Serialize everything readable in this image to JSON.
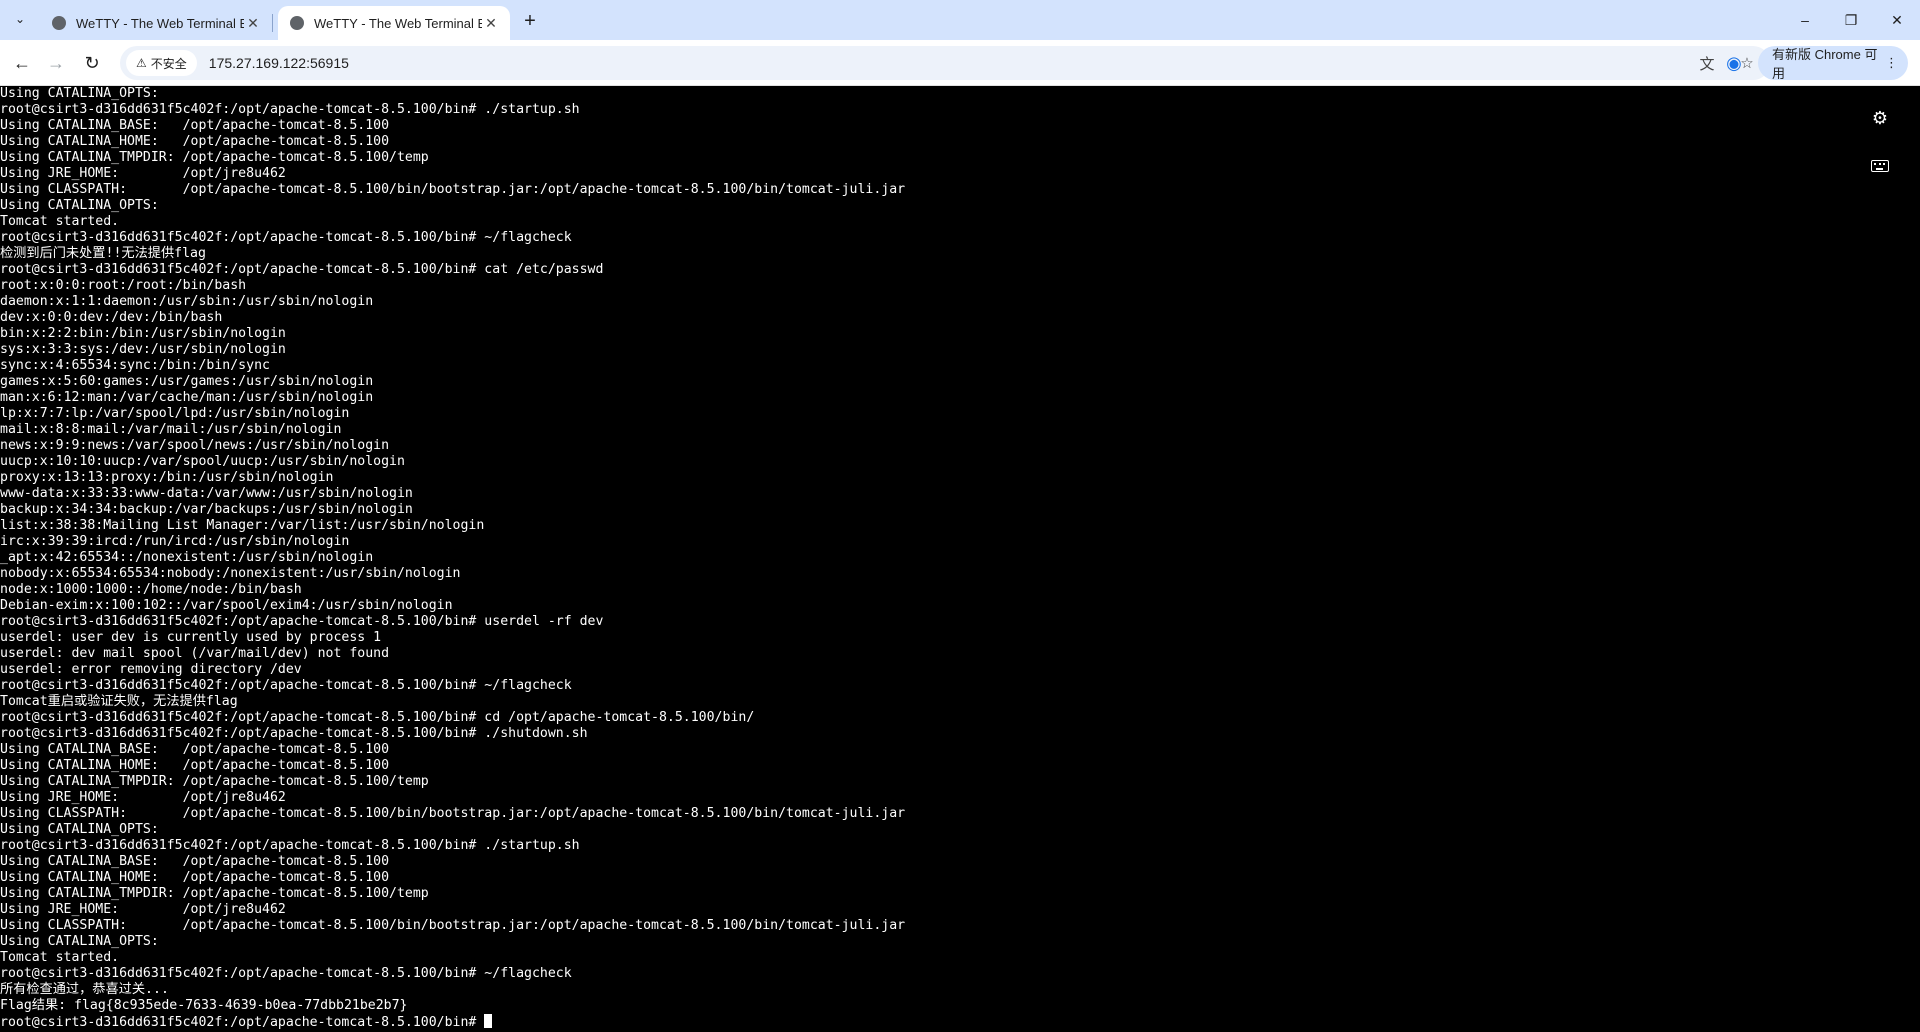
{
  "browser": {
    "tabs": [
      {
        "title": "WeTTY - The Web Terminal E",
        "active": false
      },
      {
        "title": "WeTTY - The Web Terminal E",
        "active": true
      }
    ],
    "tab_search_icon": "chevron-down-icon",
    "new_tab_icon": "plus-icon",
    "window_controls": {
      "minimize": "–",
      "maximize": "❐",
      "close": "✕"
    },
    "nav": {
      "back": "←",
      "forward": "→",
      "reload": "↻"
    },
    "security_label": "不安全",
    "url": "175.27.169.122:56915",
    "update_label": "有新版 Chrome 可用",
    "accent_color": "#d3e3fd"
  },
  "terminal": {
    "lines": [
      "Using CATALINA_OPTS:",
      "root@csirt3-d316dd631f5c402f:/opt/apache-tomcat-8.5.100/bin# ./startup.sh",
      "Using CATALINA_BASE:   /opt/apache-tomcat-8.5.100",
      "Using CATALINA_HOME:   /opt/apache-tomcat-8.5.100",
      "Using CATALINA_TMPDIR: /opt/apache-tomcat-8.5.100/temp",
      "Using JRE_HOME:        /opt/jre8u462",
      "Using CLASSPATH:       /opt/apache-tomcat-8.5.100/bin/bootstrap.jar:/opt/apache-tomcat-8.5.100/bin/tomcat-juli.jar",
      "Using CATALINA_OPTS:",
      "Tomcat started.",
      "root@csirt3-d316dd631f5c402f:/opt/apache-tomcat-8.5.100/bin# ~/flagcheck",
      "检测到后门未处置!!无法提供flag",
      "root@csirt3-d316dd631f5c402f:/opt/apache-tomcat-8.5.100/bin# cat /etc/passwd",
      "root:x:0:0:root:/root:/bin/bash",
      "daemon:x:1:1:daemon:/usr/sbin:/usr/sbin/nologin",
      "dev:x:0:0:dev:/dev:/bin/bash",
      "bin:x:2:2:bin:/bin:/usr/sbin/nologin",
      "sys:x:3:3:sys:/dev:/usr/sbin/nologin",
      "sync:x:4:65534:sync:/bin:/bin/sync",
      "games:x:5:60:games:/usr/games:/usr/sbin/nologin",
      "man:x:6:12:man:/var/cache/man:/usr/sbin/nologin",
      "lp:x:7:7:lp:/var/spool/lpd:/usr/sbin/nologin",
      "mail:x:8:8:mail:/var/mail:/usr/sbin/nologin",
      "news:x:9:9:news:/var/spool/news:/usr/sbin/nologin",
      "uucp:x:10:10:uucp:/var/spool/uucp:/usr/sbin/nologin",
      "proxy:x:13:13:proxy:/bin:/usr/sbin/nologin",
      "www-data:x:33:33:www-data:/var/www:/usr/sbin/nologin",
      "backup:x:34:34:backup:/var/backups:/usr/sbin/nologin",
      "list:x:38:38:Mailing List Manager:/var/list:/usr/sbin/nologin",
      "irc:x:39:39:ircd:/run/ircd:/usr/sbin/nologin",
      "_apt:x:42:65534::/nonexistent:/usr/sbin/nologin",
      "nobody:x:65534:65534:nobody:/nonexistent:/usr/sbin/nologin",
      "node:x:1000:1000::/home/node:/bin/bash",
      "Debian-exim:x:100:102::/var/spool/exim4:/usr/sbin/nologin",
      "root@csirt3-d316dd631f5c402f:/opt/apache-tomcat-8.5.100/bin# userdel -rf dev",
      "userdel: user dev is currently used by process 1",
      "userdel: dev mail spool (/var/mail/dev) not found",
      "userdel: error removing directory /dev",
      "root@csirt3-d316dd631f5c402f:/opt/apache-tomcat-8.5.100/bin# ~/flagcheck",
      "Tomcat重启或验证失败，无法提供flag",
      "root@csirt3-d316dd631f5c402f:/opt/apache-tomcat-8.5.100/bin# cd /opt/apache-tomcat-8.5.100/bin/",
      "root@csirt3-d316dd631f5c402f:/opt/apache-tomcat-8.5.100/bin# ./shutdown.sh",
      "Using CATALINA_BASE:   /opt/apache-tomcat-8.5.100",
      "Using CATALINA_HOME:   /opt/apache-tomcat-8.5.100",
      "Using CATALINA_TMPDIR: /opt/apache-tomcat-8.5.100/temp",
      "Using JRE_HOME:        /opt/jre8u462",
      "Using CLASSPATH:       /opt/apache-tomcat-8.5.100/bin/bootstrap.jar:/opt/apache-tomcat-8.5.100/bin/tomcat-juli.jar",
      "Using CATALINA_OPTS:",
      "root@csirt3-d316dd631f5c402f:/opt/apache-tomcat-8.5.100/bin# ./startup.sh",
      "Using CATALINA_BASE:   /opt/apache-tomcat-8.5.100",
      "Using CATALINA_HOME:   /opt/apache-tomcat-8.5.100",
      "Using CATALINA_TMPDIR: /opt/apache-tomcat-8.5.100/temp",
      "Using JRE_HOME:        /opt/jre8u462",
      "Using CLASSPATH:       /opt/apache-tomcat-8.5.100/bin/bootstrap.jar:/opt/apache-tomcat-8.5.100/bin/tomcat-juli.jar",
      "Using CATALINA_OPTS:",
      "Tomcat started.",
      "root@csirt3-d316dd631f5c402f:/opt/apache-tomcat-8.5.100/bin# ~/flagcheck",
      "所有检查通过，恭喜过关...",
      "Flag结果: flag{8c935ede-7633-4639-b0ea-77dbb21be2b7}"
    ],
    "prompt": "root@csirt3-d316dd631f5c402f:/opt/apache-tomcat-8.5.100/bin# ",
    "settings_icon": "gears-icon",
    "keyboard_icon": "keyboard-icon"
  }
}
